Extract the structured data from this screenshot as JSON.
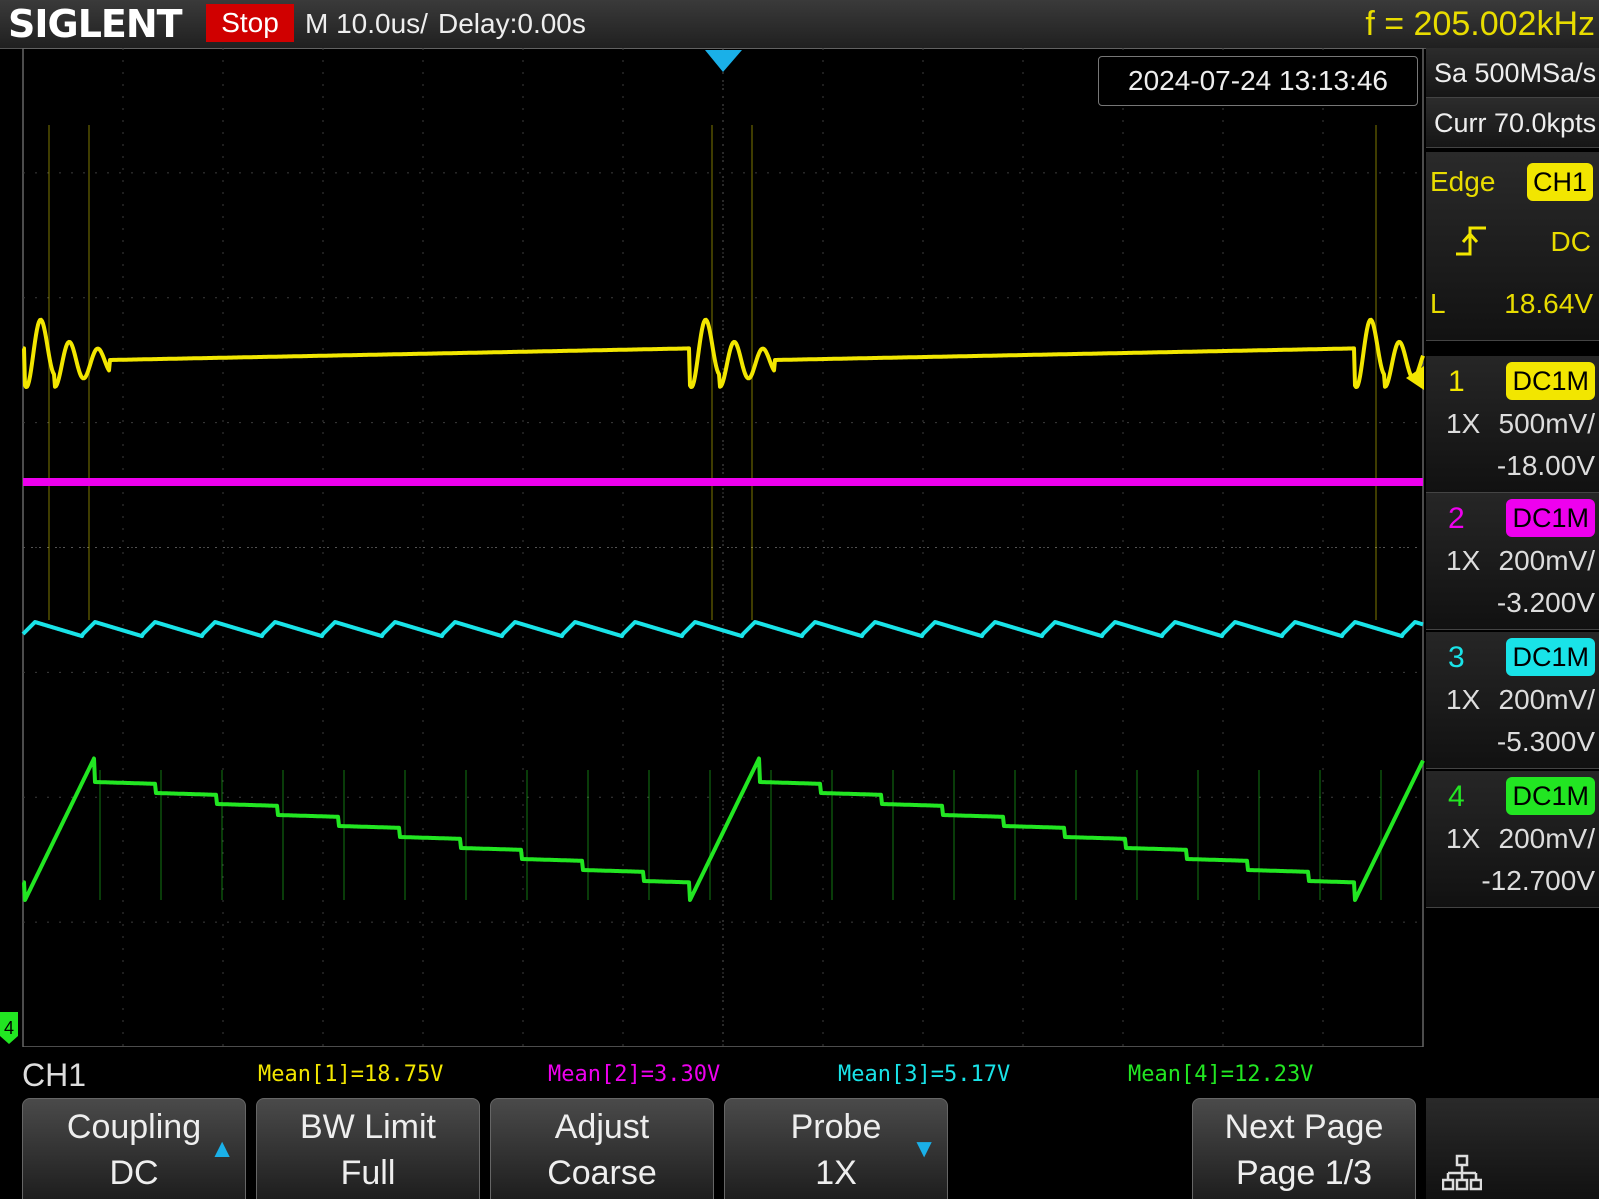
{
  "header": {
    "brand": "SIGLENT",
    "run_state": "Stop",
    "timebase": "M 10.0us/",
    "delay": "Delay:0.00s",
    "frequency": "f = 205.002kHz"
  },
  "datetime": "2024-07-24 13:13:46",
  "acquisition": {
    "sample_rate": "Sa 500MSa/s",
    "memory_depth": "Curr 70.0kpts"
  },
  "trigger": {
    "type": "Edge",
    "source": "CH1",
    "slope_icon": "rising-edge-icon",
    "coupling": "DC",
    "level_label": "L",
    "level": "18.64V"
  },
  "channels": [
    {
      "num": "1",
      "coupling": "DC1M",
      "probe": "1X",
      "scale": "500mV/",
      "offset": "-18.00V",
      "color": "#f2e600"
    },
    {
      "num": "2",
      "coupling": "DC1M",
      "probe": "1X",
      "scale": "200mV/",
      "offset": "-3.200V",
      "color": "#ee00ee"
    },
    {
      "num": "3",
      "coupling": "DC1M",
      "probe": "1X",
      "scale": "200mV/",
      "offset": "-5.300V",
      "color": "#19e3e8"
    },
    {
      "num": "4",
      "coupling": "DC1M",
      "probe": "1X",
      "scale": "200mV/",
      "offset": "-12.700V",
      "color": "#22e622"
    }
  ],
  "selected_channel": "CH1",
  "ground_marker_label": "4",
  "measurements": [
    {
      "text": "Mean[1]=18.75V",
      "color": "#f2e600"
    },
    {
      "text": "Mean[2]=3.30V",
      "color": "#ee00ee"
    },
    {
      "text": "Mean[3]=5.17V",
      "color": "#19e3e8"
    },
    {
      "text": "Mean[4]=12.23V",
      "color": "#22e622"
    }
  ],
  "softkeys": [
    {
      "line1": "Coupling",
      "line2": "DC",
      "arrow": "▲"
    },
    {
      "line1": "BW Limit",
      "line2": "Full",
      "arrow": ""
    },
    {
      "line1": "Adjust",
      "line2": "Coarse",
      "arrow": ""
    },
    {
      "line1": "Probe",
      "line2": "1X",
      "arrow": "▼"
    },
    {
      "line1": "Next Page",
      "line2": "Page 1/3",
      "arrow": ""
    }
  ],
  "network_icon": "network-icon",
  "colors": {
    "accent_blue": "#1ab0e8",
    "stop_red": "#d00000",
    "grid": "#3c3c3c"
  }
}
